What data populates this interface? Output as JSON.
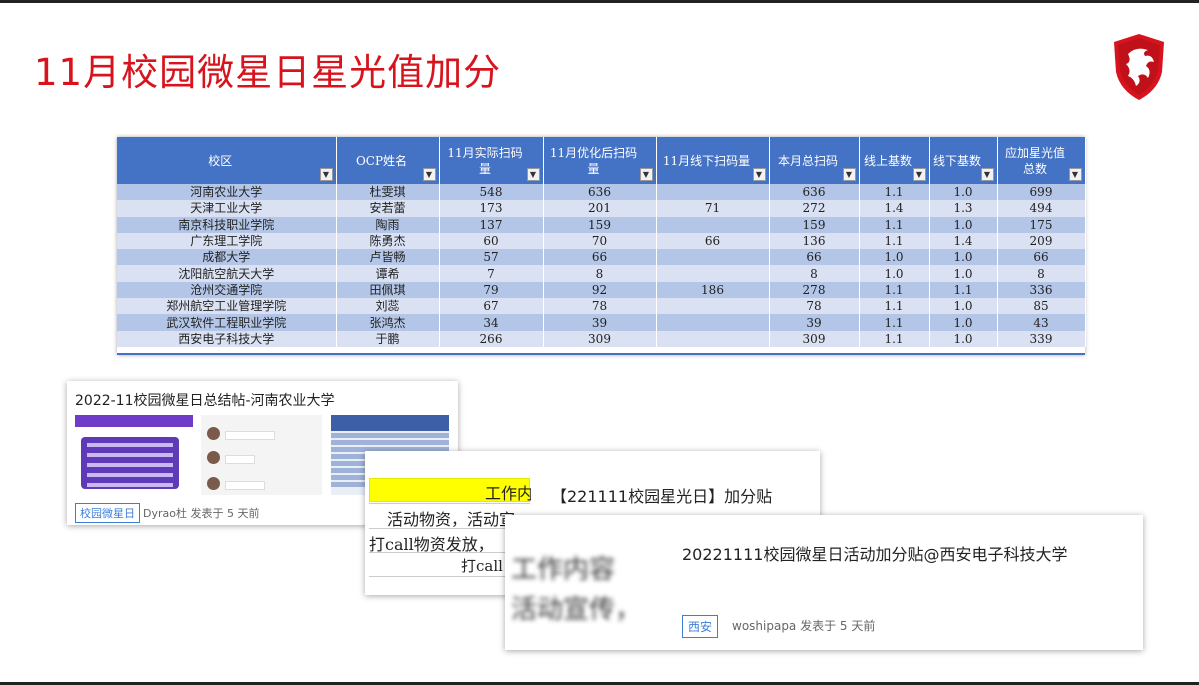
{
  "slide": {
    "title": "11月校园微星日星光值加分"
  },
  "brand": {
    "logo_icon": "msi-dragon-shield-icon",
    "accent": "#d7141d"
  },
  "table": {
    "columns": [
      "校区",
      "OCP姓名",
      "11月实际扫码量",
      "11月优化后扫码量",
      "11月线下扫码量",
      "本月总扫码",
      "线上基数",
      "线下基数",
      "应加星光值总数"
    ],
    "rows": [
      [
        "河南农业大学",
        "杜雯琪",
        "548",
        "636",
        "",
        "636",
        "1.1",
        "1.0",
        "699"
      ],
      [
        "天津工业大学",
        "安若蕾",
        "173",
        "201",
        "71",
        "272",
        "1.4",
        "1.3",
        "494"
      ],
      [
        "南京科技职业学院",
        "陶雨",
        "137",
        "159",
        "",
        "159",
        "1.1",
        "1.0",
        "175"
      ],
      [
        "广东理工学院",
        "陈勇杰",
        "60",
        "70",
        "66",
        "136",
        "1.1",
        "1.4",
        "209"
      ],
      [
        "成都大学",
        "卢皆畅",
        "57",
        "66",
        "",
        "66",
        "1.0",
        "1.0",
        "66"
      ],
      [
        "沈阳航空航天大学",
        "谭希",
        "7",
        "8",
        "",
        "8",
        "1.0",
        "1.0",
        "8"
      ],
      [
        "沧州交通学院",
        "田佩琪",
        "79",
        "92",
        "186",
        "278",
        "1.1",
        "1.1",
        "336"
      ],
      [
        "郑州航空工业管理学院",
        "刘蕊",
        "67",
        "78",
        "",
        "78",
        "1.1",
        "1.0",
        "85"
      ],
      [
        "武汉软件工程职业学院",
        "张鸿杰",
        "34",
        "39",
        "",
        "39",
        "1.1",
        "1.0",
        "43"
      ],
      [
        "西安电子科技大学",
        "于鹏",
        "266",
        "309",
        "",
        "309",
        "1.1",
        "1.0",
        "339"
      ]
    ],
    "header_color": "#4472c4",
    "row_colors": [
      "#b4c6e7",
      "#d9e1f2"
    ]
  },
  "cards": {
    "post1": {
      "title": "2022-11校园微星日总结帖-河南农业大学",
      "tag": "校园微星日",
      "meta": "Dyrao杜  发表于 5 天前"
    },
    "post2": {
      "title": "【221111校园星光日】加分贴",
      "thumb_lines": [
        "工作内",
        "活动物资，活动宣",
        "打call物资发放，",
        "打call"
      ]
    },
    "post3": {
      "title": "20221111校园微星日活动加分贴@西安电子科技大学",
      "tag": "西安",
      "meta": "woshipapa  发表于 5 天前",
      "thumb_lines": [
        "工作内容",
        "活动宣传，"
      ]
    }
  }
}
